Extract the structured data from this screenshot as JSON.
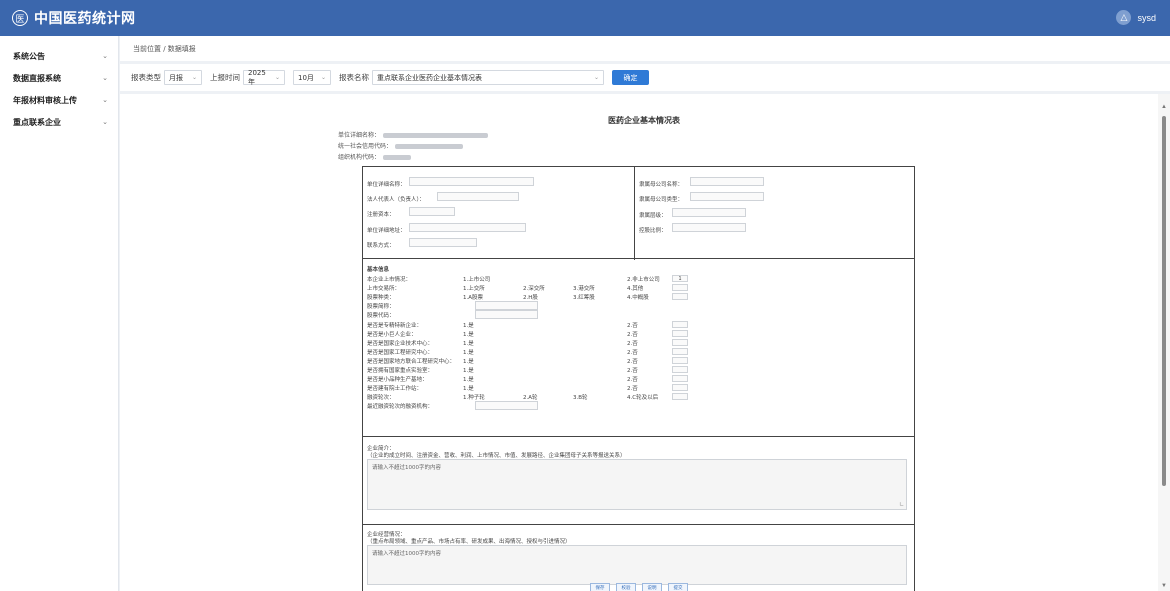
{
  "header": {
    "logo_mark": "医",
    "site_title": "中国医药统计网",
    "user_initial": "△",
    "username": "sysd"
  },
  "sidebar": {
    "items": [
      {
        "label": "系统公告"
      },
      {
        "label": "数据直报系统"
      },
      {
        "label": "年报材料审核上传"
      },
      {
        "label": "重点联系企业"
      }
    ]
  },
  "breadcrumb": "当前位置 / 数据填报",
  "filters": {
    "report_type_label": "报表类型",
    "report_type_value": "月报",
    "period_label": "上报时间",
    "year_value": "2025年",
    "month_value": "10月",
    "report_name_label": "报表名称",
    "report_name_value": "重点联系企业医药企业基本情况表",
    "confirm_label": "确定"
  },
  "form": {
    "title": "医药企业基本情况表",
    "meta_name_label": "单位详细名称：",
    "meta_credit_label": "统一社会信用代码：",
    "meta_org_label": "组织机构代码：",
    "sec1": {
      "unit_name": "单位详细名称：",
      "legal_rep": "法人代表人（负责人）：",
      "reg_capital": "注册资本：",
      "address": "单位详细地址：",
      "contact": "联系方式：",
      "parent_name": "隶属母公司名称：",
      "parent_type": "隶属母公司类型：",
      "parent_ratio": "隶属层级：",
      "holding_ratio": "控股比例："
    },
    "sec2": {
      "header": "基本信息",
      "rows": [
        {
          "label": "本企业上市情况：",
          "o1": "1.上市公司",
          "o2": "",
          "o3": "",
          "o4": "2.非上市公司",
          "box": "1"
        },
        {
          "label": "上市交易所：",
          "o1": "1.上交所",
          "o2": "2.深交所",
          "o3": "3.港交所",
          "o4": "4.其他",
          "box": ""
        },
        {
          "label": "股票种类：",
          "o1": "1.A股票",
          "o2": "2.H股",
          "o3": "3.红筹股",
          "o4": "4.中概股",
          "box": ""
        },
        {
          "label": "股票简称：",
          "o1": "",
          "o2": "",
          "o3": "",
          "o4": "",
          "box": ""
        },
        {
          "label": "股票代码：",
          "o1": "",
          "o2": "",
          "o3": "",
          "o4": "",
          "box": ""
        },
        {
          "label": "是否是专精特新企业：",
          "o1": "1.是",
          "o2": "",
          "o3": "",
          "o4": "2.否",
          "box": ""
        },
        {
          "label": "是否是小巨人企业：",
          "o1": "1.是",
          "o2": "",
          "o3": "",
          "o4": "2.否",
          "box": ""
        },
        {
          "label": "是否是国家企业技术中心：",
          "o1": "1.是",
          "o2": "",
          "o3": "",
          "o4": "2.否",
          "box": ""
        },
        {
          "label": "是否是国家工程研究中心：",
          "o1": "1.是",
          "o2": "",
          "o3": "",
          "o4": "2.否",
          "box": ""
        },
        {
          "label": "是否是国家地方联合工程研究中心：",
          "o1": "1.是",
          "o2": "",
          "o3": "",
          "o4": "2.否",
          "box": ""
        },
        {
          "label": "是否拥有国家重点实验室：",
          "o1": "1.是",
          "o2": "",
          "o3": "",
          "o4": "2.否",
          "box": ""
        },
        {
          "label": "是否是小品种生产基地：",
          "o1": "1.是",
          "o2": "",
          "o3": "",
          "o4": "2.否",
          "box": ""
        },
        {
          "label": "是否建有院士工作站：",
          "o1": "1.是",
          "o2": "",
          "o3": "",
          "o4": "2.否",
          "box": ""
        },
        {
          "label": "融资轮次：",
          "o1": "1.种子轮",
          "o2": "2.A轮",
          "o3": "3.B轮",
          "o4": "4.C轮及以后",
          "box": ""
        },
        {
          "label": "最近融资轮次的融资机构：",
          "o1": "",
          "o2": "",
          "o3": "",
          "o4": "",
          "box": ""
        }
      ]
    },
    "sec3": {
      "title": "企业简介：",
      "hint": "（企业的成立时间、注册资金、营收、利润、上市情况、市值、发展路径、企业集团母子关系等报送关系）",
      "placeholder": "请输入不超过1000字的内容"
    },
    "sec4": {
      "title": "企业经营情况：",
      "hint": "（重点布局领域、重点产品、市场占有率、研发成果、出海情况、授权与引进情况）",
      "placeholder": "请输入不超过1000字的内容"
    },
    "buttons": [
      "保存",
      "校验",
      "说明",
      "提交"
    ]
  }
}
